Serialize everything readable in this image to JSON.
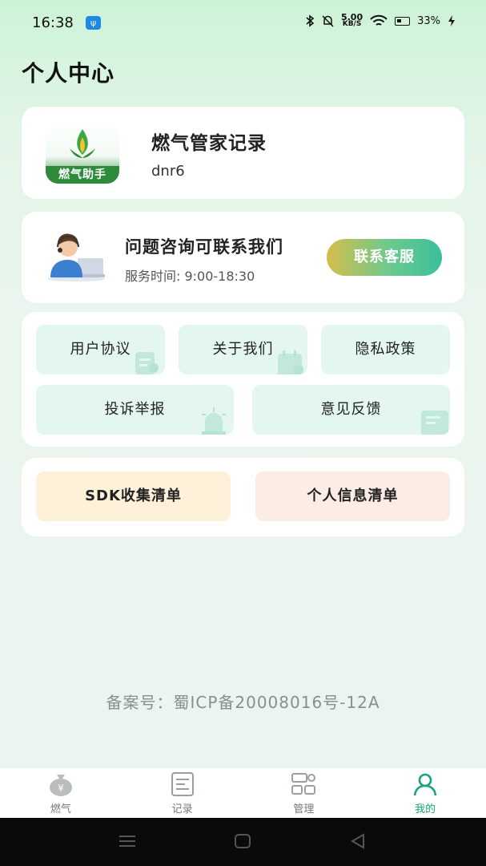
{
  "status_bar": {
    "time": "16:38",
    "net_speed_value": "5.00",
    "net_speed_unit": "KB/S",
    "battery": "33%"
  },
  "page": {
    "title": "个人中心"
  },
  "profile": {
    "app_name": "燃气管家记录",
    "user_id": "dnr6",
    "logo_text": "燃气助手"
  },
  "contact": {
    "title": "问题咨询可联系我们",
    "hours": "服务时间: 9:00-18:30",
    "button_label": "联系客服"
  },
  "links": {
    "user_agreement": "用户协议",
    "about_us": "关于我们",
    "privacy_policy": "隐私政策",
    "complaint": "投诉举报",
    "feedback": "意见反馈"
  },
  "lists": {
    "sdk_list": "SDK收集清单",
    "personal_info_list": "个人信息清单"
  },
  "footer": {
    "icp": "备案号：蜀ICP备20008016号-12A"
  },
  "tabs": [
    {
      "label": "燃气",
      "icon": "money-bag-icon"
    },
    {
      "label": "记录",
      "icon": "receipt-icon"
    },
    {
      "label": "管理",
      "icon": "management-icon"
    },
    {
      "label": "我的",
      "icon": "user-icon",
      "active": true
    }
  ],
  "colors": {
    "accent": "#1aa37a",
    "tile_green": "#e3f6ef",
    "sdk_tile": "#fdf1d9",
    "info_tile": "#fcece6"
  }
}
